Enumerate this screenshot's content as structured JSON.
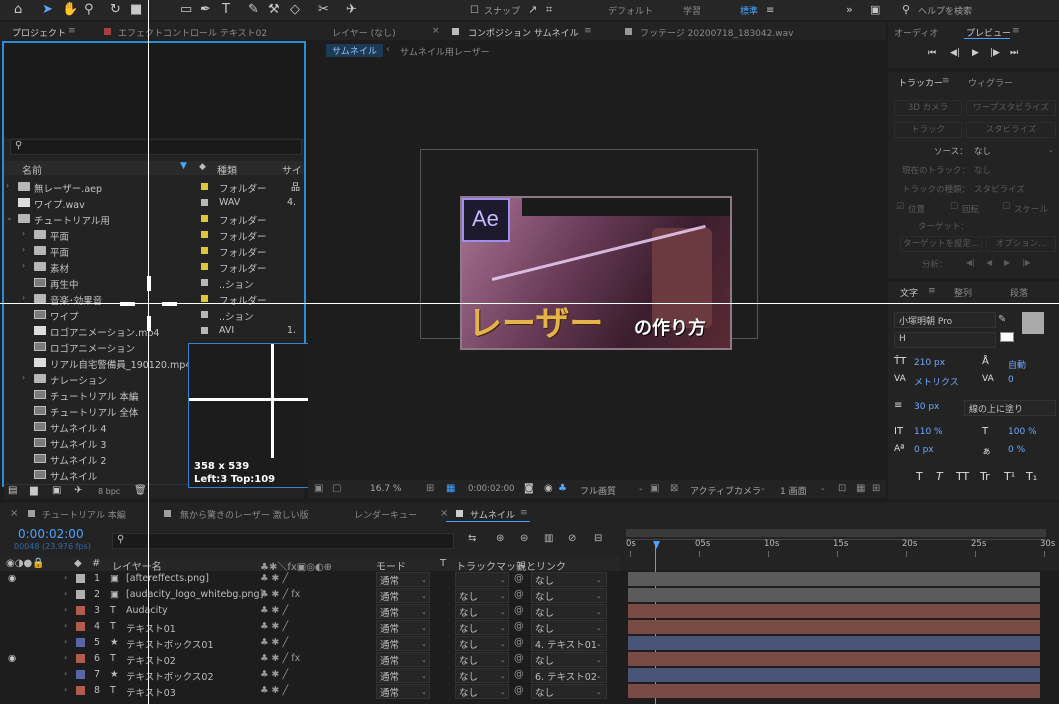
{
  "toolbar": {
    "snap_label": "スナップ",
    "workspaces": [
      "デフォルト",
      "学習",
      "標準"
    ],
    "search_placeholder": "ヘルプを検索"
  },
  "project_panel": {
    "tab_project": "プロジェクト",
    "tab_effect_controls": "エフェクトコントロール テキスト02",
    "header_name": "名前",
    "header_type": "種類",
    "header_size": "サイ",
    "rows": [
      {
        "name": "無レーザー.aep",
        "type": "フォルダー",
        "size": "",
        "indent": 0,
        "kind": "folder",
        "label": "#e0c43a",
        "expand": "›"
      },
      {
        "name": "ワイプ.wav",
        "type": "WAV",
        "size": "4.",
        "indent": 0,
        "kind": "file",
        "label": "#b7b7b7",
        "expand": ""
      },
      {
        "name": "チュートリアル用",
        "type": "フォルダー",
        "size": "",
        "indent": 0,
        "kind": "folder",
        "label": "#e0c43a",
        "expand": "⌄"
      },
      {
        "name": "平面",
        "type": "フォルダー",
        "size": "",
        "indent": 1,
        "kind": "folder",
        "label": "#e0c43a",
        "expand": "›"
      },
      {
        "name": "平面",
        "type": "フォルダー",
        "size": "",
        "indent": 1,
        "kind": "folder",
        "label": "#e0c43a",
        "expand": "›"
      },
      {
        "name": "素材",
        "type": "フォルダー",
        "size": "",
        "indent": 1,
        "kind": "folder",
        "label": "#e0c43a",
        "expand": "›"
      },
      {
        "name": "再生中",
        "type": "..ション",
        "size": "",
        "indent": 1,
        "kind": "comp",
        "label": "#b7b7b7",
        "expand": ""
      },
      {
        "name": "音楽･効果音",
        "type": "フォルダー",
        "size": "",
        "indent": 1,
        "kind": "folder",
        "label": "#e0c43a",
        "expand": "›"
      },
      {
        "name": "ワイプ",
        "type": "..ション",
        "size": "",
        "indent": 1,
        "kind": "comp",
        "label": "#b7b7b7",
        "expand": ""
      },
      {
        "name": "ロゴアニメーション.mp4",
        "type": "AVI",
        "size": "1.",
        "indent": 1,
        "kind": "file",
        "label": "#b7b7b7",
        "expand": ""
      },
      {
        "name": "ロゴアニメーション",
        "type": "",
        "size": "",
        "indent": 1,
        "kind": "comp",
        "label": "#b7b7b7",
        "expand": ""
      },
      {
        "name": "リアル自宅警備員_190120.mp4",
        "type": "",
        "size": "",
        "indent": 1,
        "kind": "file",
        "label": "#b7b7b7",
        "expand": ""
      },
      {
        "name": "ナレーション",
        "type": "",
        "size": "",
        "indent": 1,
        "kind": "folder",
        "label": "",
        "expand": "›"
      },
      {
        "name": "チュートリアル 本編",
        "type": "",
        "size": "",
        "indent": 1,
        "kind": "comp",
        "label": "",
        "expand": ""
      },
      {
        "name": "チュートリアル 全体",
        "type": "",
        "size": "",
        "indent": 1,
        "kind": "comp",
        "label": "",
        "expand": ""
      },
      {
        "name": "サムネイル 4",
        "type": "",
        "size": "",
        "indent": 1,
        "kind": "comp",
        "label": "",
        "expand": ""
      },
      {
        "name": "サムネイル 3",
        "type": "",
        "size": "",
        "indent": 1,
        "kind": "comp",
        "label": "",
        "expand": ""
      },
      {
        "name": "サムネイル 2",
        "type": "",
        "size": "",
        "indent": 1,
        "kind": "comp",
        "label": "",
        "expand": ""
      },
      {
        "name": "サムネイル",
        "type": "",
        "size": "",
        "indent": 1,
        "kind": "comp",
        "label": "",
        "expand": ""
      }
    ],
    "bpc": "8 bpc"
  },
  "measure_tooltip": {
    "size": "358 x 539",
    "position": "Left:3 Top:109"
  },
  "viewer": {
    "tab_layer": "レイヤー (なし)",
    "tab_composition": "コンポジション サムネイル",
    "tab_footage": "フッテージ 20200718_183042.wav",
    "breadcrumb_current": "サムネイル",
    "breadcrumb_next": "サムネイル用レーザー",
    "thumb_logo": "Ae",
    "thumb_title_big": "レーザー",
    "thumb_title_small": "の作り方",
    "zoom": "16.7 %",
    "timecode": "0:00:02:00",
    "resolution": "フル画質",
    "camera": "アクティブカメラ",
    "views": "1 画面"
  },
  "right_panels": {
    "tab_audio": "オーディオ",
    "tab_preview": "プレビュー",
    "tab_tracker": "トラッカー",
    "tab_wiggler": "ウィグラー",
    "tracker_buttons": [
      "3D カメラ",
      "ワープスタビライズ",
      "トラック",
      "スタビライズ"
    ],
    "source_label": "ソース：",
    "source_value": "なし",
    "current_track_label": "現在のトラック：",
    "current_track_value": "なし",
    "track_type_label": "トラックの種類：",
    "track_type_value": "スタビライズ",
    "checks": [
      "位置",
      "回転",
      "スケール"
    ],
    "target_label": "ターゲット：",
    "set_target": "ターゲットを設定...",
    "options": "オプション...",
    "analyze": "分析：",
    "tab_character": "文字",
    "tab_align": "整列",
    "tab_paragraph": "段落",
    "font_name": "小塚明朝 Pro",
    "font_style": "H",
    "font_size": "210 px",
    "leading": "自動",
    "kerning": "メトリクス",
    "tracking": "0",
    "stroke_width": "30 px",
    "stroke_mode": "線の上に塗り",
    "vscale": "110 %",
    "hscale": "100 %",
    "baseline": "0 px",
    "tsume": "0 %",
    "style_buttons": [
      "T",
      "T",
      "TT",
      "Tr",
      "T¹",
      "T₁"
    ]
  },
  "timeline": {
    "tab_main": "チュートリアル 本編",
    "tab_laser": "無から驚きのレーザー 激しい版",
    "tab_render": "レンダーキュー",
    "tab_thumb": "サムネイル",
    "timecode": "0:00:02:00",
    "frames": "00048 (23.976 fps)",
    "col_layer_name": "レイヤー名",
    "col_mode": "モード",
    "col_track_matte": "トラックマット",
    "col_parent": "親とリンク",
    "col_t": "T",
    "ruler": [
      "0s",
      "05s",
      "10s",
      "15s",
      "20s",
      "25s",
      "30s"
    ],
    "layers": [
      {
        "num": "1",
        "type": "img",
        "name": "[aftereffects.png]",
        "mode": "通常",
        "matte": "",
        "parent": "なし",
        "color": "#b0b0b0",
        "bar": "#5b5b5b",
        "eye": true,
        "fx": false
      },
      {
        "num": "2",
        "type": "img",
        "name": "[audacity_logo_whitebg.png]",
        "mode": "通常",
        "matte": "なし",
        "parent": "なし",
        "color": "#b0b0b0",
        "bar": "#5b5b5b",
        "eye": false,
        "fx": true
      },
      {
        "num": "3",
        "type": "T",
        "name": "Audacity",
        "mode": "通常",
        "matte": "なし",
        "parent": "なし",
        "color": "#b45a4e",
        "bar": "#7a4a44",
        "eye": false,
        "fx": false
      },
      {
        "num": "4",
        "type": "T",
        "name": "テキスト01",
        "mode": "通常",
        "matte": "なし",
        "parent": "なし",
        "color": "#b45a4e",
        "bar": "#7a4a44",
        "eye": false,
        "fx": false
      },
      {
        "num": "5",
        "type": "star",
        "name": "テキストボックス01",
        "mode": "通常",
        "matte": "なし",
        "parent": "4. テキスト01",
        "color": "#5866a8",
        "bar": "#4a5477",
        "eye": false,
        "fx": false
      },
      {
        "num": "6",
        "type": "T",
        "name": "テキスト02",
        "mode": "通常",
        "matte": "なし",
        "parent": "なし",
        "color": "#b45a4e",
        "bar": "#7a4a44",
        "eye": true,
        "fx": true
      },
      {
        "num": "7",
        "type": "star",
        "name": "テキストボックス02",
        "mode": "通常",
        "matte": "なし",
        "parent": "6. テキスト02",
        "color": "#5866a8",
        "bar": "#4a5477",
        "eye": false,
        "fx": false
      },
      {
        "num": "8",
        "type": "T",
        "name": "テキスト03",
        "mode": "通常",
        "matte": "なし",
        "parent": "なし",
        "color": "#b45a4e",
        "bar": "#7a4a44",
        "eye": false,
        "fx": false
      }
    ]
  }
}
